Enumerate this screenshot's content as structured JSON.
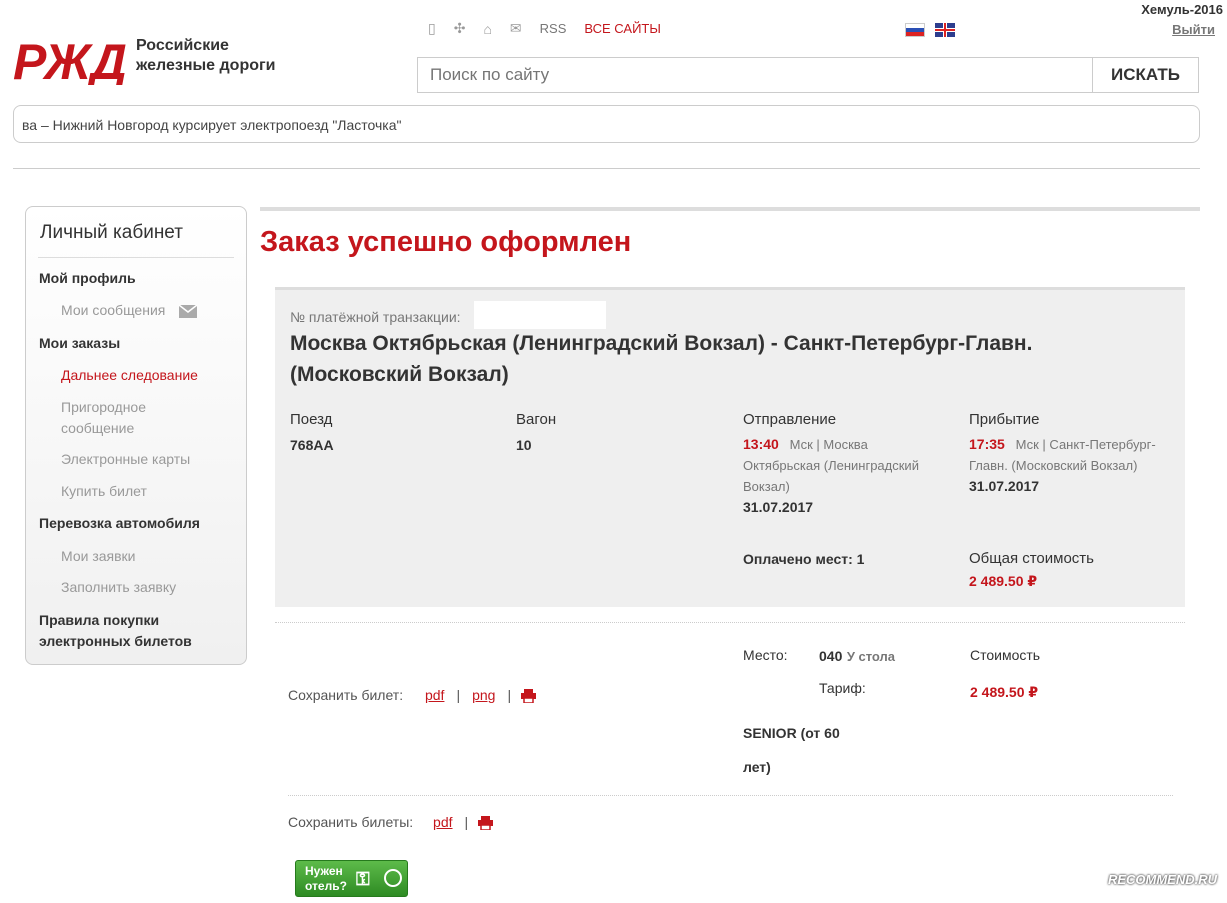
{
  "brand": {
    "line1": "Российские",
    "line2": "железные дороги"
  },
  "topnav": {
    "rss": "RSS",
    "all_sites": "ВСЕ САЙТЫ"
  },
  "user": {
    "name": "Хемуль-2016",
    "logout": "Выйти"
  },
  "search": {
    "placeholder": "Поиск по сайту",
    "button": "ИСКАТЬ"
  },
  "ticker": "ва – Нижний Новгород курсирует электропоезд \"Ласточка\"",
  "sidebar": {
    "title": "Личный кабинет",
    "profile": "Мой профиль",
    "messages": "Мои сообщения",
    "orders": "Мои заказы",
    "long_distance": "Дальнее следование",
    "suburban_1": "Пригородное",
    "suburban_2": "сообщение",
    "cards": "Электронные карты",
    "buy": "Купить билет",
    "car_transport": "Перевозка автомобиля",
    "my_requests": "Мои заявки",
    "fill_request": "Заполнить заявку",
    "rules_1": "Правила покупки",
    "rules_2": "электронных билетов"
  },
  "order": {
    "title": "Заказ успешно оформлен",
    "txn_label": "№ платёжной транзакции:",
    "route_1": "Москва Октябрьская (Ленинградский Вокзал) - Санкт-Петербург-Главн.",
    "route_2": "(Московский Вокзал)",
    "train_label": "Поезд",
    "train": "768АА",
    "car_label": "Вагон",
    "car": "10",
    "dep_label": "Отправление",
    "dep_time": "13:40",
    "dep_place_1": "Мск | Москва",
    "dep_place_2": "Октябрьская (Ленинградский",
    "dep_place_3": "Вокзал)",
    "dep_date": "31.07.2017",
    "arr_label": "Прибытие",
    "arr_time": "17:35",
    "arr_place_1": "Мск | Санкт-Петербург-",
    "arr_place_2": "Главн. (Московский Вокзал)",
    "arr_date": "31.07.2017",
    "paid_seats": "Оплачено мест: 1",
    "total_label": "Общая стоимость",
    "total": "2 489.50 ₽"
  },
  "ticket": {
    "save_label": "Сохранить билет:",
    "pdf": "pdf",
    "png": "png",
    "seat_label": "Место:",
    "seat_num": "040",
    "seat_type": "У стола",
    "tariff_label": "Тариф:",
    "tariff_1": "SENIOR (от 60",
    "tariff_2": "лет)",
    "cost_label": "Стоимость",
    "cost": "2 489.50 ₽"
  },
  "tickets_save": {
    "label": "Сохранить билеты:",
    "pdf": "pdf"
  },
  "hotel": {
    "line1": "Нужен",
    "line2": "отель?"
  },
  "watermark": "RECOMMEND.RU",
  "colors": {
    "brand_red": "#c4161c",
    "hotel_green": "#3a9a2c"
  }
}
